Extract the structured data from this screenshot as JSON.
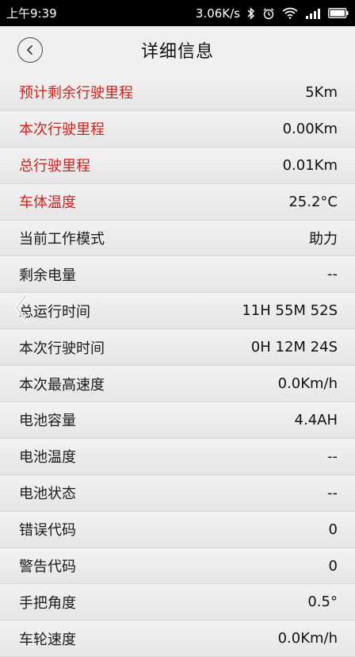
{
  "status_bar": {
    "time": "上午9:39",
    "speed": "3.06K/s"
  },
  "header": {
    "title": "详细信息"
  },
  "rows": [
    {
      "label": "预计剩余行驶里程",
      "value": "5Km",
      "highlight": true
    },
    {
      "label": "本次行驶里程",
      "value": "0.00Km",
      "highlight": true
    },
    {
      "label": "总行驶里程",
      "value": "0.01Km",
      "highlight": true
    },
    {
      "label": "车体温度",
      "value": "25.2°C",
      "highlight": true
    },
    {
      "label": "当前工作模式",
      "value": "助力",
      "highlight": false
    },
    {
      "label": "剩余电量",
      "value": "--",
      "highlight": false
    },
    {
      "label": "总运行时间",
      "value": "11H 55M 52S",
      "highlight": false
    },
    {
      "label": "本次行驶时间",
      "value": "0H 12M 24S",
      "highlight": false
    },
    {
      "label": "本次最高速度",
      "value": "0.0Km/h",
      "highlight": false
    },
    {
      "label": "电池容量",
      "value": "4.4AH",
      "highlight": false
    },
    {
      "label": "电池温度",
      "value": "--",
      "highlight": false
    },
    {
      "label": "电池状态",
      "value": "--",
      "highlight": false
    },
    {
      "label": "错误代码",
      "value": "0",
      "highlight": false
    },
    {
      "label": "警告代码",
      "value": "0",
      "highlight": false
    },
    {
      "label": "手把角度",
      "value": "0.5°",
      "highlight": false
    },
    {
      "label": "车轮速度",
      "value": "0.0Km/h",
      "highlight": false
    }
  ],
  "colors": {
    "highlight": "#d0211c",
    "background": "#ededed"
  }
}
